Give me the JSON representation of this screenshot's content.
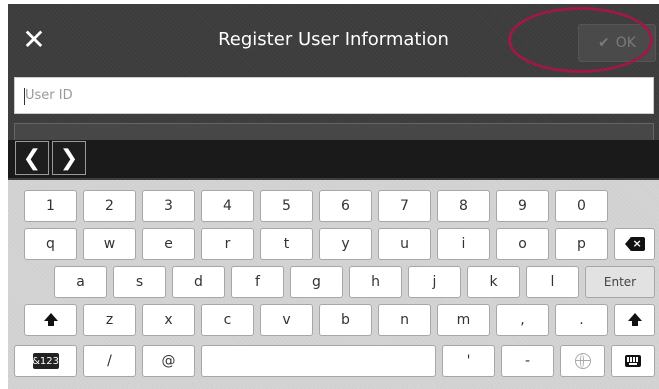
{
  "header": {
    "title": "Register User Information",
    "close_symbol": "✕",
    "ok_label": "OK",
    "ok_check": "✔"
  },
  "form": {
    "userid_placeholder": "User ID",
    "userid_value": ""
  },
  "navigation": {
    "left_arrow": "❮",
    "right_arrow": "❯"
  },
  "keyboard": {
    "row1": [
      "1",
      "2",
      "3",
      "4",
      "5",
      "6",
      "7",
      "8",
      "9",
      "0"
    ],
    "row2": [
      "q",
      "w",
      "e",
      "r",
      "t",
      "y",
      "u",
      "i",
      "o",
      "p"
    ],
    "row3": [
      "a",
      "s",
      "d",
      "f",
      "g",
      "h",
      "j",
      "k",
      "l"
    ],
    "row3_enter": "Enter",
    "row4": [
      "z",
      "x",
      "c",
      "v",
      "b",
      "n",
      "m",
      ",",
      "."
    ],
    "row5_mode": "&123",
    "row5_slash": "/",
    "row5_at": "@",
    "row5_space": "",
    "row5_apostrophe": "'",
    "row5_dash": "-"
  },
  "colors": {
    "highlight": "#9b1a46",
    "panel": "#3c3c3c",
    "keyboard_bg": "#d4d4d4"
  }
}
